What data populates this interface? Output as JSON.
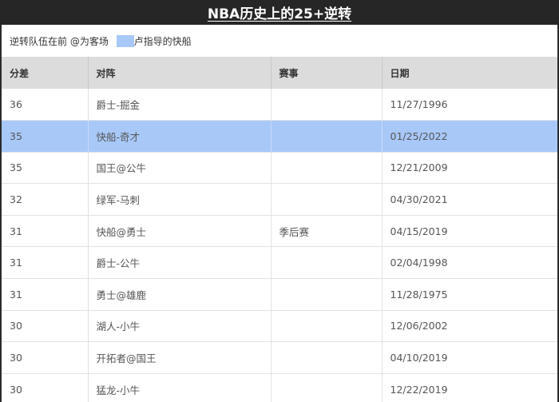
{
  "title": "NBA历史上的25+逆转",
  "legend": {
    "text_before": "逆转队伍在前 @为客场 ",
    "text_after": "卢指导的快船",
    "highlight_color": "#a8c8f8"
  },
  "table": {
    "headers": [
      "分差",
      "对阵",
      "赛事",
      "日期"
    ],
    "rows": [
      {
        "margin": "36",
        "matchup": "爵士-掘金",
        "event": "",
        "date": "11/27/1996",
        "highlight": false
      },
      {
        "margin": "35",
        "matchup": "快船-奇才",
        "event": "",
        "date": "01/25/2022",
        "highlight": true
      },
      {
        "margin": "35",
        "matchup": "国王@公牛",
        "event": "",
        "date": "12/21/2009",
        "highlight": false
      },
      {
        "margin": "32",
        "matchup": "绿军-马刺",
        "event": "",
        "date": "04/30/2021",
        "highlight": false
      },
      {
        "margin": "31",
        "matchup": "快船@勇士",
        "event": "季后赛",
        "date": "04/15/2019",
        "highlight": false
      },
      {
        "margin": "31",
        "matchup": "爵士-公牛",
        "event": "",
        "date": "02/04/1998",
        "highlight": false
      },
      {
        "margin": "31",
        "matchup": "勇士@雄鹿",
        "event": "",
        "date": "11/28/1975",
        "highlight": false
      },
      {
        "margin": "30",
        "matchup": "湖人-小牛",
        "event": "",
        "date": "12/06/2002",
        "highlight": false
      },
      {
        "margin": "30",
        "matchup": "开拓者@国王",
        "event": "",
        "date": "04/10/2019",
        "highlight": false
      },
      {
        "margin": "30",
        "matchup": "猛龙-小牛",
        "event": "",
        "date": "12/22/2019",
        "highlight": false
      }
    ]
  }
}
